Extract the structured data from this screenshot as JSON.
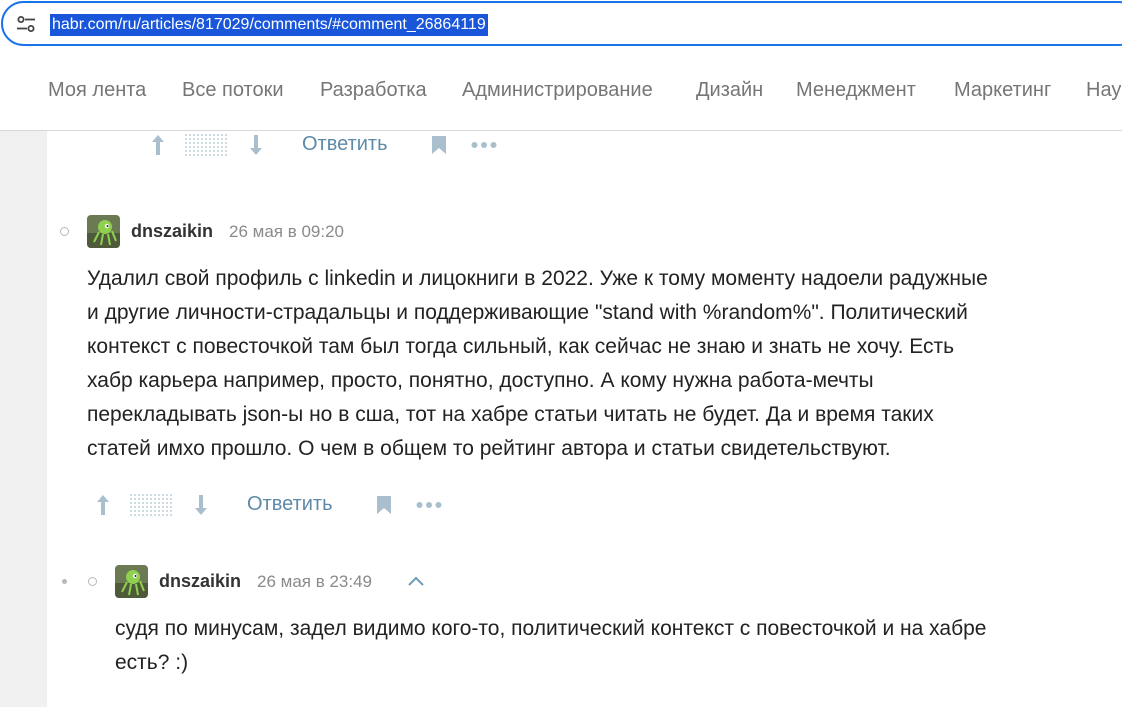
{
  "browser": {
    "url": "habr.com/ru/articles/817029/comments/#comment_26864119"
  },
  "nav": {
    "items": [
      "Моя лента",
      "Все потоки",
      "Разработка",
      "Администрирование",
      "Дизайн",
      "Менеджмент",
      "Маркетинг",
      "Нау"
    ]
  },
  "actions": {
    "reply_label": "Ответить"
  },
  "comments": [
    {
      "author": "dnszaikin",
      "time": "26 мая в 09:20",
      "lines": [
        "Удалил свой профиль с linkedin и лицокниги в 2022. Уже к тому моменту надоели радужные",
        "и другие личности-страдальцы и поддерживающие \"stand with %random%\". Политический",
        "контекст с повесточкой там был тогда сильный, как сейчас не знаю и знать не хочу. Есть",
        "хабр карьера например, просто, понятно, доступно. А кому нужна работа-мечты",
        "перекладывать json-ы но в сша, тот на хабре статьи читать не будет. Да и время таких",
        "статей имхо прошло. О чем в общем то рейтинг автора и статьи свидетельствуют."
      ]
    },
    {
      "author": "dnszaikin",
      "time": "26 мая в 23:49",
      "lines": [
        "судя по минусам, задел видимо кого-то, политический контекст с повесточкой и на хабре",
        "есть? :)"
      ]
    }
  ],
  "icons": {
    "accent": "#1a73e8",
    "link_color": "#5e8aa8"
  }
}
